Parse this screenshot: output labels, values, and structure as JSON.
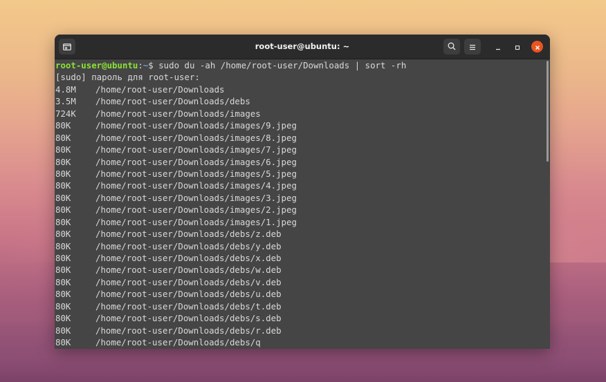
{
  "window": {
    "title": "root-user@ubuntu: ~"
  },
  "icons": {
    "new_tab": "new-tab-icon",
    "search": "search-icon",
    "menu": "hamburger-menu-icon",
    "minimize": "minimize-icon",
    "maximize": "maximize-icon",
    "close": "close-icon"
  },
  "colors": {
    "terminal_bg": "#454545",
    "prompt_user": "#8ae234",
    "prompt_path": "#729fcf",
    "close_button": "#e95420"
  },
  "terminal": {
    "prompt_user": "root-user@ubuntu",
    "prompt_sep": ":",
    "prompt_path": "~",
    "prompt_symbol": "$ ",
    "command": "sudo du -ah /home/root-user/Downloads | sort -rh",
    "sudo_prompt": "[sudo] пароль для root-user:",
    "rows": [
      {
        "size": "4.8M",
        "path": "/home/root-user/Downloads"
      },
      {
        "size": "3.5M",
        "path": "/home/root-user/Downloads/debs"
      },
      {
        "size": "724K",
        "path": "/home/root-user/Downloads/images"
      },
      {
        "size": "80K",
        "path": "/home/root-user/Downloads/images/9.jpeg"
      },
      {
        "size": "80K",
        "path": "/home/root-user/Downloads/images/8.jpeg"
      },
      {
        "size": "80K",
        "path": "/home/root-user/Downloads/images/7.jpeg"
      },
      {
        "size": "80K",
        "path": "/home/root-user/Downloads/images/6.jpeg"
      },
      {
        "size": "80K",
        "path": "/home/root-user/Downloads/images/5.jpeg"
      },
      {
        "size": "80K",
        "path": "/home/root-user/Downloads/images/4.jpeg"
      },
      {
        "size": "80K",
        "path": "/home/root-user/Downloads/images/3.jpeg"
      },
      {
        "size": "80K",
        "path": "/home/root-user/Downloads/images/2.jpeg"
      },
      {
        "size": "80K",
        "path": "/home/root-user/Downloads/images/1.jpeg"
      },
      {
        "size": "80K",
        "path": "/home/root-user/Downloads/debs/z.deb"
      },
      {
        "size": "80K",
        "path": "/home/root-user/Downloads/debs/y.deb"
      },
      {
        "size": "80K",
        "path": "/home/root-user/Downloads/debs/x.deb"
      },
      {
        "size": "80K",
        "path": "/home/root-user/Downloads/debs/w.deb"
      },
      {
        "size": "80K",
        "path": "/home/root-user/Downloads/debs/v.deb"
      },
      {
        "size": "80K",
        "path": "/home/root-user/Downloads/debs/u.deb"
      },
      {
        "size": "80K",
        "path": "/home/root-user/Downloads/debs/t.deb"
      },
      {
        "size": "80K",
        "path": "/home/root-user/Downloads/debs/s.deb"
      },
      {
        "size": "80K",
        "path": "/home/root-user/Downloads/debs/r.deb"
      },
      {
        "size": "80K",
        "path": "/home/root-user/Downloads/debs/q"
      }
    ]
  }
}
